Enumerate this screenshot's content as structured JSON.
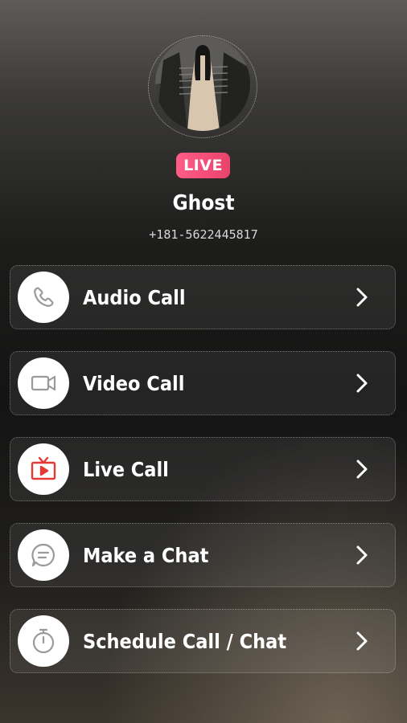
{
  "profile": {
    "badge": "LIVE",
    "name": "Ghost",
    "phone": "+181-5622445817"
  },
  "menu": [
    {
      "label": "Audio Call",
      "icon": "phone-icon"
    },
    {
      "label": "Video Call",
      "icon": "video-camera-icon"
    },
    {
      "label": "Live Call",
      "icon": "live-tv-icon"
    },
    {
      "label": "Make a Chat",
      "icon": "chat-bubble-icon"
    },
    {
      "label": "Schedule Call / Chat",
      "icon": "stopwatch-icon"
    }
  ],
  "colors": {
    "badge": "#ff5c87",
    "live_icon": "#e53935",
    "icon_gray": "#9a9a9a"
  }
}
